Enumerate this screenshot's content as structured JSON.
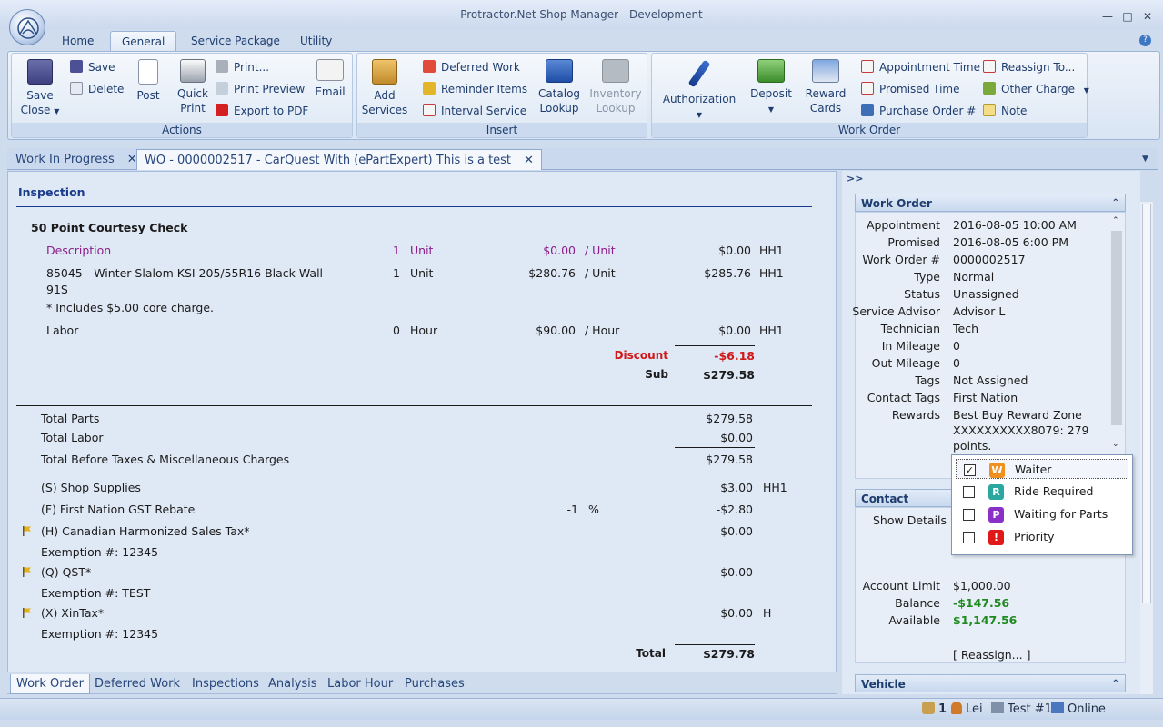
{
  "window": {
    "title": "Protractor.Net Shop Manager - Development"
  },
  "ribbon_tabs": [
    "Home",
    "General",
    "Service Package",
    "Utility"
  ],
  "ribbon": {
    "actions": {
      "label": "Actions",
      "save_close": "Save",
      "save_close2": "Close",
      "save": "Save",
      "delete": "Delete",
      "post": "Post",
      "quick_print": "Quick",
      "quick_print2": "Print",
      "print": "Print...",
      "print_preview": "Print Preview",
      "export_pdf": "Export to PDF",
      "email": "Email"
    },
    "insert": {
      "label": "Insert",
      "add_services": "Add",
      "add_services2": "Services",
      "deferred_work": "Deferred Work",
      "reminder_items": "Reminder Items",
      "interval_service": "Interval Service",
      "catalog_lookup": "Catalog",
      "catalog_lookup2": "Lookup",
      "inventory_lookup": "Inventory",
      "inventory_lookup2": "Lookup"
    },
    "work_order": {
      "label": "Work Order",
      "authorization": "Authorization",
      "deposit": "Deposit",
      "reward_cards": "Reward",
      "reward_cards2": "Cards",
      "appointment_time": "Appointment Time",
      "promised_time": "Promised Time",
      "purchase_order": "Purchase Order #",
      "reassign_to": "Reassign To...",
      "other_charge": "Other Charge",
      "note": "Note"
    }
  },
  "doc_tabs": [
    "Work In Progress",
    "WO - 0000002517 - CarQuest With (ePartExpert) This is a test"
  ],
  "inspection": {
    "section_title": "Inspection",
    "package_title": "50 Point Courtesy Check",
    "lines": [
      {
        "desc": "Description",
        "qty": "1",
        "unit": "Unit",
        "price": "$0.00",
        "per": "/ Unit",
        "total": "$0.00",
        "code": "HH1"
      },
      {
        "desc": "85045 - Winter Slalom KSI 205/55R16 Black Wall",
        "desc2": "91S",
        "qty": "1",
        "unit": "Unit",
        "price": "$280.76",
        "per": "/ Unit",
        "total": "$285.76",
        "code": "HH1"
      },
      {
        "desc": "* Includes $5.00 core charge."
      },
      {
        "desc": "Labor",
        "qty": "0",
        "unit": "Hour",
        "price": "$90.00",
        "per": "/ Hour",
        "total": "$0.00",
        "code": "HH1"
      }
    ],
    "discount_label": "Discount",
    "discount_value": "-$6.18",
    "sub_label": "Sub",
    "sub_value": "$279.58"
  },
  "totals": {
    "total_parts_label": "Total Parts",
    "total_parts": "$279.58",
    "total_labor_label": "Total Labor",
    "total_labor": "$0.00",
    "before_taxes_label": "Total Before Taxes & Miscellaneous Charges",
    "before_taxes": "$279.58",
    "shop_supplies_label": "(S) Shop Supplies",
    "shop_supplies": "$3.00",
    "shop_supplies_code": "HH1",
    "gst_rebate_label": "(F) First Nation GST Rebate",
    "gst_rebate_pct": "-1",
    "gst_rebate_unit": "%",
    "gst_rebate": "-$2.80",
    "hst_label": "(H) Canadian Harmonized Sales Tax*",
    "hst": "$0.00",
    "hst_exempt": "Exemption #: 12345",
    "qst_label": "(Q) QST*",
    "qst": "$0.00",
    "qst_exempt": "Exemption #: TEST",
    "xintax_label": "(X) XinTax*",
    "xintax": "$0.00",
    "xintax_code": "H",
    "xintax_exempt": "Exemption #: 12345",
    "total_label": "Total",
    "total": "$279.78"
  },
  "bottom_tabs": [
    "Work Order",
    "Deferred Work",
    "Inspections",
    "Analysis",
    "Labor Hour",
    "Purchases"
  ],
  "right_panel": {
    "expand": ">>",
    "work_order_header": "Work Order",
    "fields": [
      {
        "label": "Appointment",
        "value": "2016-08-05 10:00 AM"
      },
      {
        "label": "Promised",
        "value": "2016-08-05 6:00 PM"
      },
      {
        "label": "Work Order #",
        "value": "0000002517"
      },
      {
        "label": "Type",
        "value": "Normal"
      },
      {
        "label": "Status",
        "value": "Unassigned"
      },
      {
        "label": "Service Advisor",
        "value": "Advisor L"
      },
      {
        "label": "Technician",
        "value": "Tech"
      },
      {
        "label": "In Mileage",
        "value": "0"
      },
      {
        "label": "Out Mileage",
        "value": "0"
      },
      {
        "label": "Tags",
        "value": "Not Assigned"
      },
      {
        "label": "Contact Tags",
        "value": "First Nation"
      },
      {
        "label": "Rewards",
        "value": "Best Buy Reward Zone",
        "value2": "XXXXXXXXXX8079: 279",
        "value3": "points."
      }
    ],
    "contact_header": "Contact",
    "show_details": "Show Details",
    "account_limit_label": "Account Limit",
    "account_limit": "$1,000.00",
    "balance_label": "Balance",
    "balance": "-$147.56",
    "available_label": "Available",
    "available": "$1,147.56",
    "reassign": "[ Reassign... ]",
    "vehicle_header": "Vehicle"
  },
  "tag_popup": [
    {
      "label": "Waiter",
      "letter": "W",
      "color": "#f0901e",
      "checked": true
    },
    {
      "label": "Ride Required",
      "letter": "R",
      "color": "#2aa8a0",
      "checked": false
    },
    {
      "label": "Waiting for Parts",
      "letter": "P",
      "color": "#8b2fc9",
      "checked": false
    },
    {
      "label": "Priority",
      "letter": "!",
      "color": "#e01818",
      "checked": false
    }
  ],
  "status": {
    "messages": "1",
    "user": "Lei",
    "terminal": "Test #1",
    "connection": "Online"
  }
}
